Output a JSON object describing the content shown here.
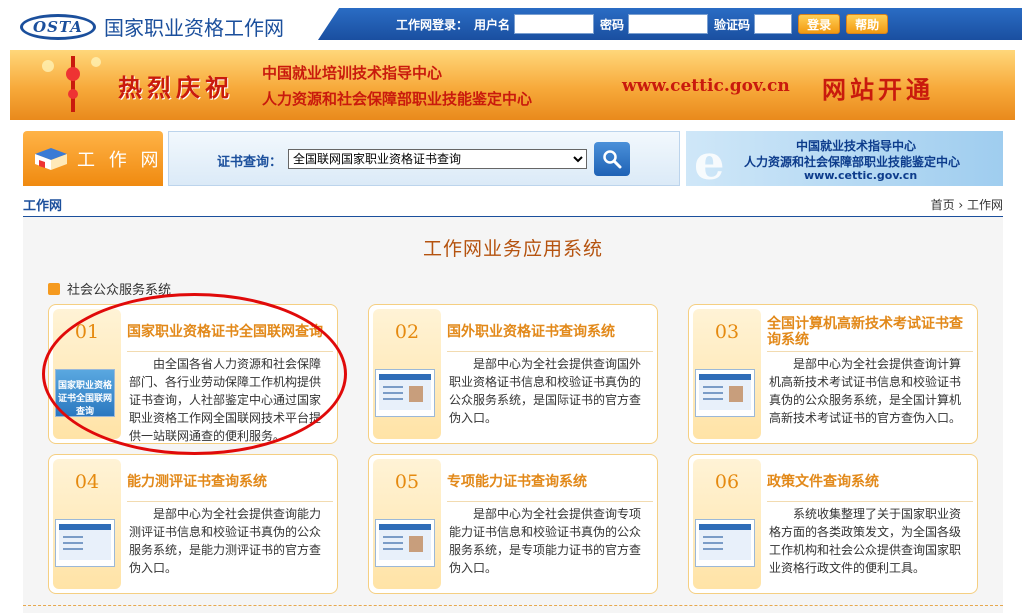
{
  "header": {
    "logo_mark": "OSTA",
    "site_name": "国家职业资格工作网",
    "login_label": "工作网登录：",
    "username_label": "用户名",
    "password_label": "密码",
    "captcha_label": "验证码",
    "login_button": "登录",
    "help_button": "帮助"
  },
  "banner": {
    "line1": "热烈庆祝",
    "org1": "中国就业培训技术指导中心",
    "org2": "人力资源和社会保障部职业技能鉴定中心",
    "url": "www.cettic.gov.cn",
    "tail": "网站开通"
  },
  "nav": {
    "worknet_tab": "工 作 网",
    "cert_query_label": "证书查询：",
    "cert_query_selected": "全国联网国家职业资格证书查询",
    "ad_line1": "中国就业技术指导中心",
    "ad_line2": "人力资源和社会保障部职业技能鉴定中心",
    "ad_line3": "www.cettic.gov.cn"
  },
  "breadcrumb": {
    "current": "工作网",
    "path": "首页 › 工作网"
  },
  "main": {
    "title": "工作网业务应用系统",
    "section": "社会公众服务系统",
    "cards": [
      {
        "num": "01",
        "title": "国家职业资格证书全国联网查询",
        "thumb": "国家职业资格证书全国联网查询",
        "desc": "由全国各省人力资源和社会保障部门、各行业劳动保障工作机构提供证书查询，人社部鉴定中心通过国家职业资格工作网全国联网技术平台提供一站联网通查的便利服务。"
      },
      {
        "num": "02",
        "title": "国外职业资格证书查询系统",
        "desc": "是部中心为全社会提供查询国外职业资格证书信息和校验证书真伪的公众服务系统，是国际证书的官方查伪入口。"
      },
      {
        "num": "03",
        "title": "全国计算机高新技术考试证书查询系统",
        "desc": "是部中心为全社会提供查询计算机高新技术考试证书信息和校验证书真伪的公众服务系统，是全国计算机高新技术考试证书的官方查伪入口。"
      },
      {
        "num": "04",
        "title": "能力测评证书查询系统",
        "desc": "是部中心为全社会提供查询能力测评证书信息和校验证书真伪的公众服务系统，是能力测评证书的官方查伪入口。"
      },
      {
        "num": "05",
        "title": "专项能力证书查询系统",
        "desc": "是部中心为全社会提供查询专项能力证书信息和校验证书真伪的公众服务系统，是专项能力证书的官方查伪入口。"
      },
      {
        "num": "06",
        "title": "政策文件查询系统",
        "desc": "系统收集整理了关于国家职业资格方面的各类政策发文，为全国各级工作机构和社会公众提供查询国家职业资格行政文件的便利工具。"
      }
    ]
  },
  "colors": {
    "brand_blue": "#1b4f9c",
    "accent_orange": "#e2891a",
    "highlight_red": "#e00a0a"
  }
}
